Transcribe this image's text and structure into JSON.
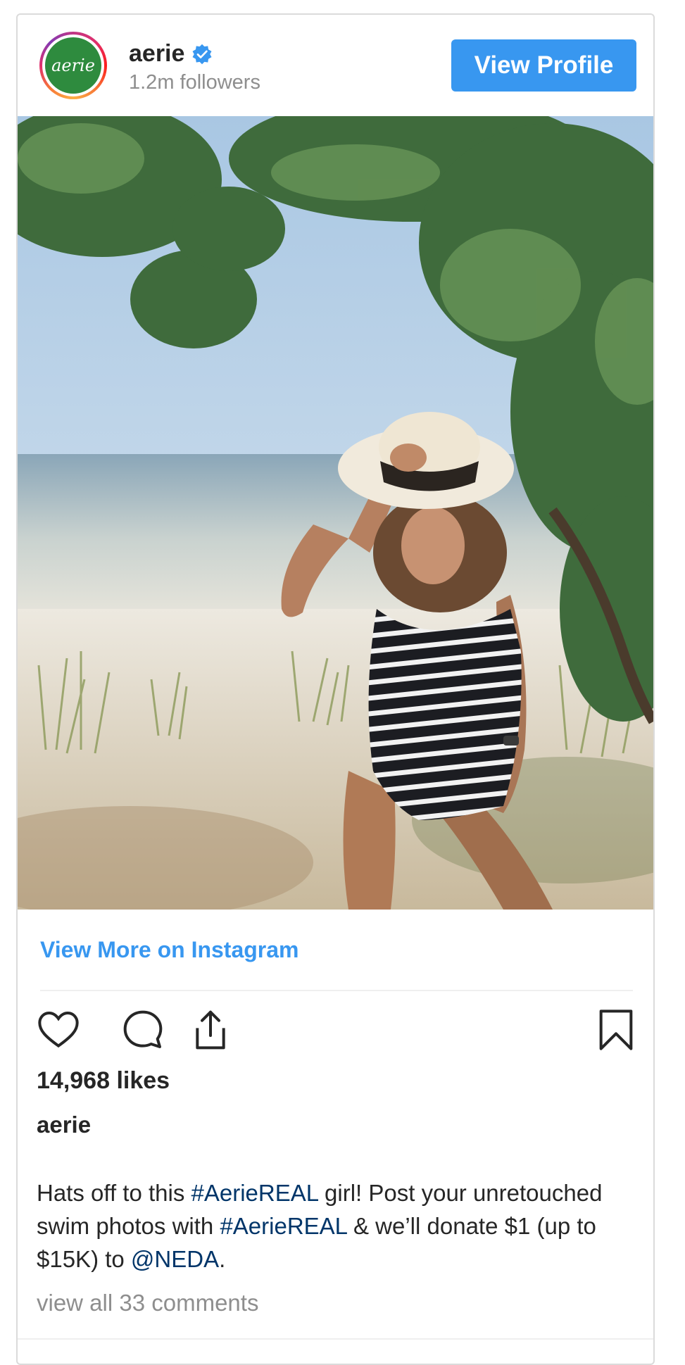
{
  "header": {
    "avatar_text": "aerie",
    "username": "aerie",
    "verified_icon": "verified-badge-icon",
    "followers": "1.2m followers",
    "view_profile_label": "View Profile"
  },
  "photo": {
    "description_icon": "post-photo"
  },
  "footer": {
    "view_more_label": "View More on Instagram",
    "actions": {
      "like_icon": "heart-icon",
      "comment_icon": "comment-icon",
      "share_icon": "share-icon",
      "save_icon": "bookmark-icon"
    },
    "likes": "14,968 likes",
    "caption_user": "aerie",
    "caption": {
      "part1": "Hats off to this ",
      "tag1": "#AerieREAL",
      "part2": " girl! Post your unretouched swim photos with ",
      "tag2": "#AerieREAL",
      "part3": " & we’ll donate $1 (up to $15K) to ",
      "mention": "@NEDA",
      "part4": "."
    },
    "view_comments": "view all 33 comments"
  },
  "colors": {
    "accent": "#3897f0",
    "link": "#003569",
    "muted": "#8e8e8e",
    "text": "#262626",
    "avatar_bg": "#2e8b3e"
  }
}
